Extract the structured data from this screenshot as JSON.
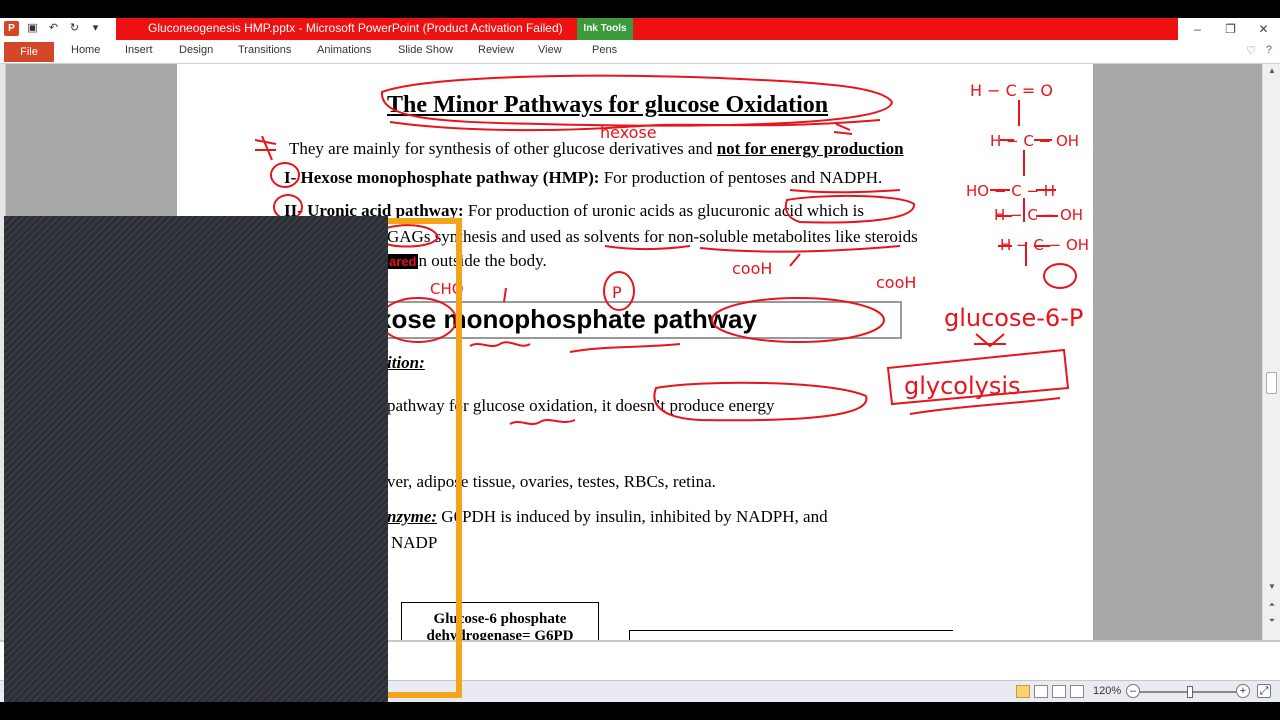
{
  "window": {
    "title": "Gluconeogenesis HMP.pptx - Microsoft PowerPoint (Product Activation Failed)",
    "context_tab_group": "Ink Tools"
  },
  "ribbon": {
    "tabs": [
      "File",
      "Home",
      "Insert",
      "Design",
      "Transitions",
      "Animations",
      "Slide Show",
      "Review",
      "View",
      "Pens"
    ]
  },
  "slide": {
    "title": "The Minor Pathways for glucose Oxidation",
    "intro_prefix": "They are mainly for synthesis of other glucose derivatives and ",
    "intro_bold": "not for energy production",
    "item1_bold": "I- Hexose monophosphate pathway (HMP):",
    "item1_rest": " For production of pentoses and NADPH.",
    "item2_bold": "II- Uronic acid pathway:",
    "item2_rest": "  For production of uronic acids as glucuronic acid which is",
    "item2_line2": "GAGs synthesis and used as solvents for non-soluble metabolites like steroids",
    "item2_line3": "n outside the body.",
    "item2_badge": "ared",
    "heading": "xose monophosphate pathway",
    "definition": "ition:",
    "def_line": "pathway for glucose oxidation, it doesn’t produce energy",
    "site_line": "ver, adipose tissue, ovaries, testes, RBCs, retina.",
    "enzyme_label": "nzyme:",
    "enzyme_text": " G6PDH is induced by insulin, inhibited by NADPH, and",
    "enzyme_line2": "NADP",
    "box1_line1": "Glucose-6 phosphate",
    "box1_line2": "dehydrogenase= G6PD"
  },
  "status": {
    "zoom": "120%"
  },
  "annotations": {
    "hexose": "hexose",
    "cooh1": "cooH",
    "cooh2": "cooH",
    "glucose6p": "glucose-6-P",
    "glycolysis": "glycolysis",
    "p": "P",
    "cho": "CHO"
  },
  "colors": {
    "ink": "#e8141b",
    "title_bar": "#ee1111",
    "file_tab": "#d24726",
    "overlay_frame": "#f5a31a"
  }
}
